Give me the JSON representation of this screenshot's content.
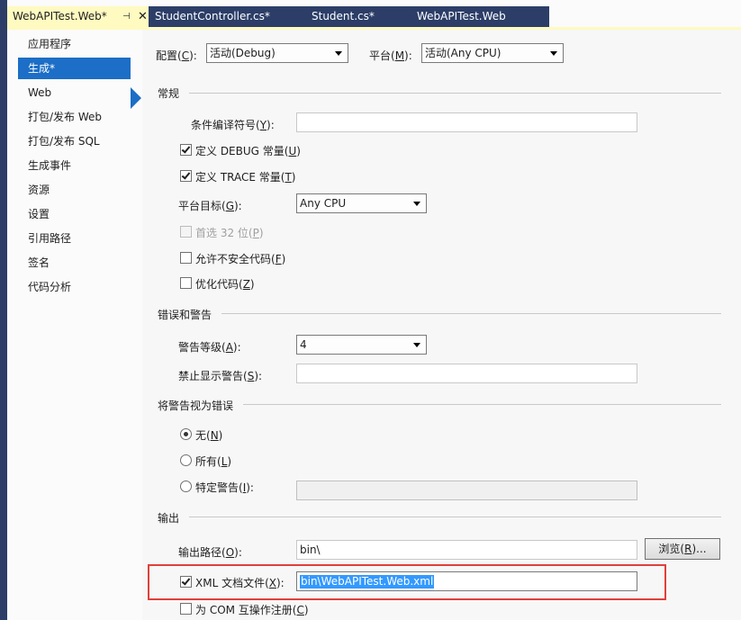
{
  "tabs": {
    "active": "WebAPITest.Web*",
    "pin": "⊣",
    "close": "✕",
    "others": [
      "StudentController.cs*",
      "Student.cs*",
      "WebAPITest.Web"
    ]
  },
  "sidebar": {
    "items": [
      "应用程序",
      "生成*",
      "Web",
      "打包/发布 Web",
      "打包/发布 SQL",
      "生成事件",
      "资源",
      "设置",
      "引用路径",
      "签名",
      "代码分析"
    ],
    "selected_index": 1
  },
  "top": {
    "config_label": "配置(",
    "config_key": "C",
    "config_end": "):",
    "config_value": "活动(Debug)",
    "platform_label": "平台(",
    "platform_key": "M",
    "platform_end": "):",
    "platform_value": "活动(Any CPU)"
  },
  "general": {
    "title": "常规",
    "symbols_label": "条件编译符号(",
    "symbols_key": "Y",
    "symbols_end": "):",
    "symbols_value": "",
    "debug_label": "定义 DEBUG 常量(",
    "debug_key": "U",
    "debug_end": ")",
    "debug_checked": true,
    "trace_label": "定义 TRACE 常量(",
    "trace_key": "T",
    "trace_end": ")",
    "trace_checked": true,
    "target_label": "平台目标(",
    "target_key": "G",
    "target_end": "):",
    "target_value": "Any CPU",
    "prefer32_label": "首选 32 位(",
    "prefer32_key": "P",
    "prefer32_end": ")",
    "unsafe_label": "允许不安全代码(",
    "unsafe_key": "F",
    "unsafe_end": ")",
    "optimize_label": "优化代码(",
    "optimize_key": "Z",
    "optimize_end": ")"
  },
  "errors": {
    "title": "错误和警告",
    "level_label": "警告等级(",
    "level_key": "A",
    "level_end": "):",
    "level_value": "4",
    "suppress_label": "禁止显示警告(",
    "suppress_key": "S",
    "suppress_end": "):",
    "suppress_value": ""
  },
  "treat": {
    "title": "将警告视为错误",
    "none_label": "无(",
    "none_key": "N",
    "none_end": ")",
    "all_label": "所有(",
    "all_key": "L",
    "all_end": ")",
    "specific_label": "特定警告(",
    "specific_key": "I",
    "specific_end": "):",
    "specific_value": "",
    "selected": "none"
  },
  "output": {
    "title": "输出",
    "path_label": "输出路径(",
    "path_key": "O",
    "path_end": "):",
    "path_value": "bin\\",
    "browse_label": "浏览(",
    "browse_key": "R",
    "browse_end": ")...",
    "xml_label": "XML 文档文件(",
    "xml_key": "X",
    "xml_end": "):",
    "xml_checked": true,
    "xml_value": "bin\\WebAPITest.Web.xml",
    "com_label": "为 COM 互操作注册(",
    "com_key": "C",
    "com_end": ")"
  },
  "colors": {
    "accent": "#1c6ec6",
    "tab_bar": "#2c3e68",
    "active_tab": "#fefac0",
    "highlight": "#e0403a"
  }
}
